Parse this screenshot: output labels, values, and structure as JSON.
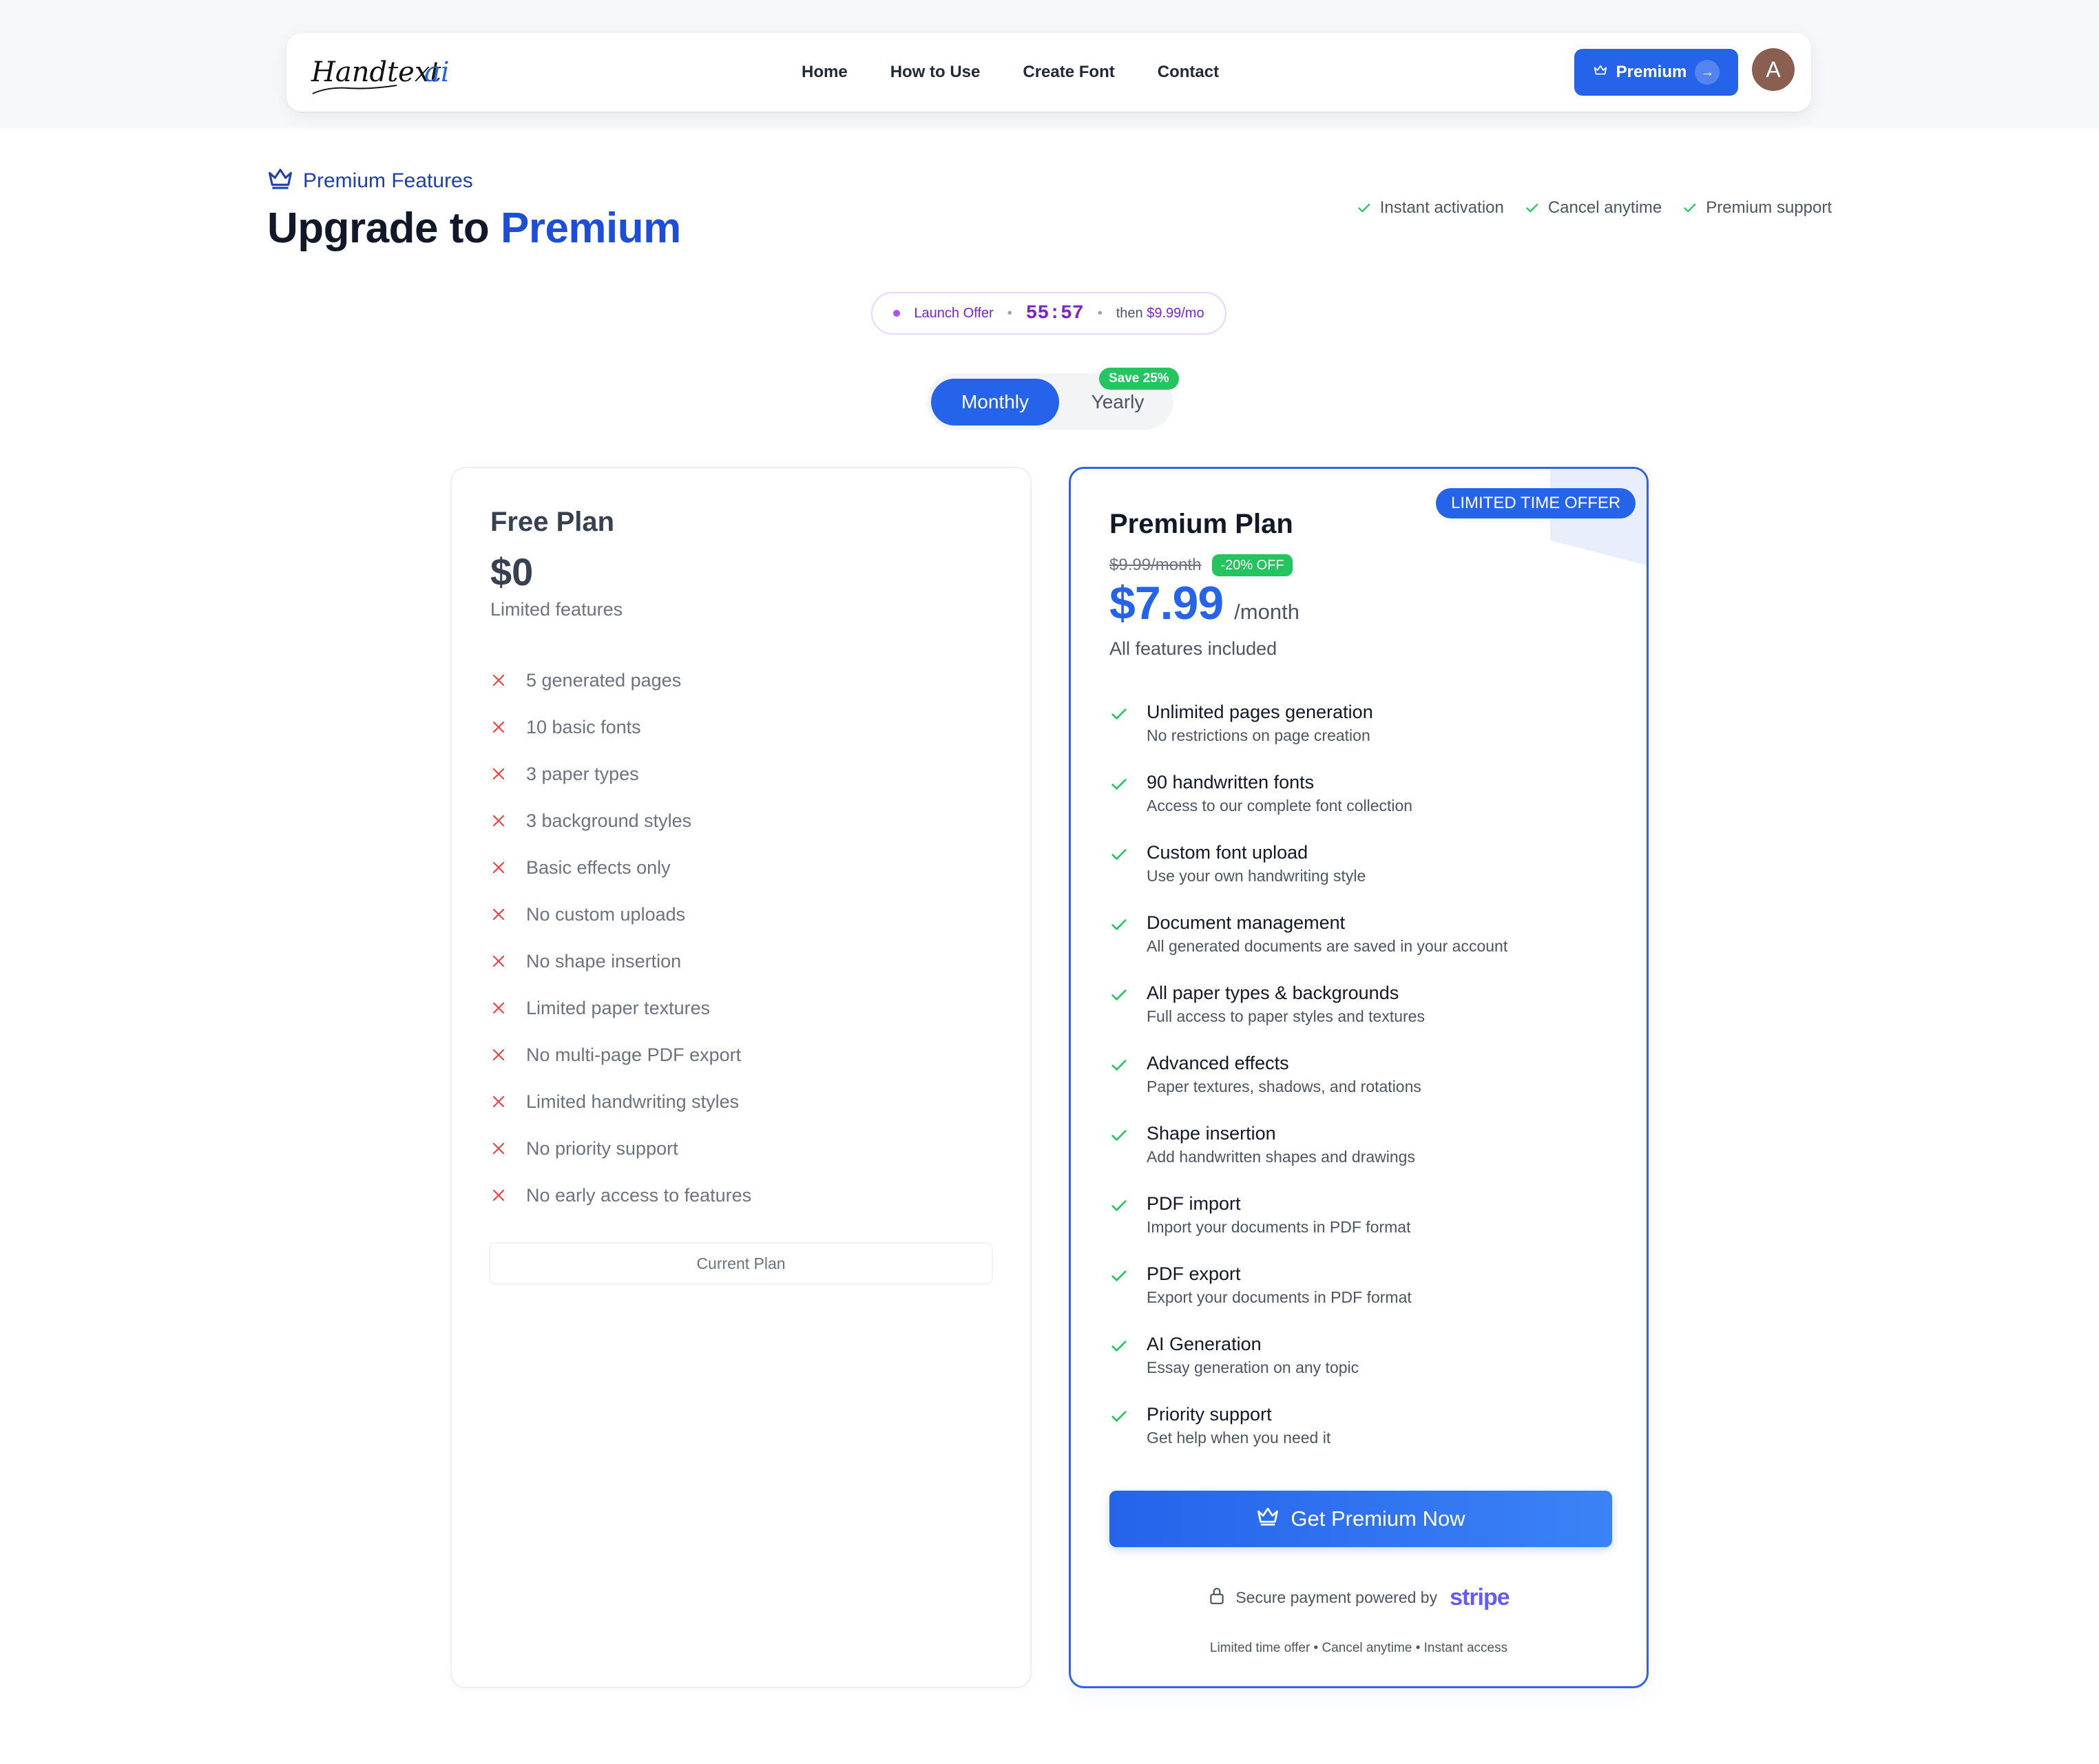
{
  "nav": {
    "logo_text": "Handtextai",
    "links": [
      "Home",
      "How to Use",
      "Create Font",
      "Contact"
    ],
    "premium_button": "Premium",
    "avatar_initial": "A"
  },
  "hero": {
    "tag": "Premium Features",
    "title_prefix": "Upgrade to",
    "title_accent": "Premium",
    "assurances": [
      "Instant activation",
      "Cancel anytime",
      "Premium support"
    ]
  },
  "offer": {
    "label": "Launch Offer",
    "timer": "55:57",
    "then_prefix": "then",
    "then_price": "$9.99/mo"
  },
  "billing": {
    "monthly": "Monthly",
    "yearly": "Yearly",
    "save_badge": "Save 25%",
    "selected": "Monthly"
  },
  "free_plan": {
    "name": "Free Plan",
    "price": "$0",
    "subtitle": "Limited features",
    "features": [
      "5 generated pages",
      "10 basic fonts",
      "3 paper types",
      "3 background styles",
      "Basic effects only",
      "No custom uploads",
      "No shape insertion",
      "Limited paper textures",
      "No multi-page PDF export",
      "Limited handwriting styles",
      "No priority support",
      "No early access to features"
    ],
    "button": "Current Plan"
  },
  "premium_plan": {
    "badge": "LIMITED TIME OFFER",
    "name": "Premium Plan",
    "old_price": "$9.99/month",
    "discount": "-20% OFF",
    "price": "$7.99",
    "period": "/month",
    "subtitle": "All features included",
    "features": [
      {
        "title": "Unlimited pages generation",
        "desc": "No restrictions on page creation"
      },
      {
        "title": "90 handwritten fonts",
        "desc": "Access to our complete font collection"
      },
      {
        "title": "Custom font upload",
        "desc": "Use your own handwriting style"
      },
      {
        "title": "Document management",
        "desc": "All generated documents are saved in your account"
      },
      {
        "title": "All paper types & backgrounds",
        "desc": "Full access to paper styles and textures"
      },
      {
        "title": "Advanced effects",
        "desc": "Paper textures, shadows, and rotations"
      },
      {
        "title": "Shape insertion",
        "desc": "Add handwritten shapes and drawings"
      },
      {
        "title": "PDF import",
        "desc": "Import your documents in PDF format"
      },
      {
        "title": "PDF export",
        "desc": "Export your documents in PDF format"
      },
      {
        "title": "AI Generation",
        "desc": "Essay generation on any topic"
      },
      {
        "title": "Priority support",
        "desc": "Get help when you need it"
      }
    ],
    "cta": "Get Premium Now",
    "secure_text": "Secure payment powered by",
    "stripe": "stripe",
    "footnote": "Limited time offer • Cancel anytime • Instant access"
  },
  "colors": {
    "brand": "#2563eb",
    "accent_dark": "#1d4ed8",
    "success": "#22c55e",
    "danger": "#ef4444",
    "offer_purple": "#7e22ce"
  }
}
